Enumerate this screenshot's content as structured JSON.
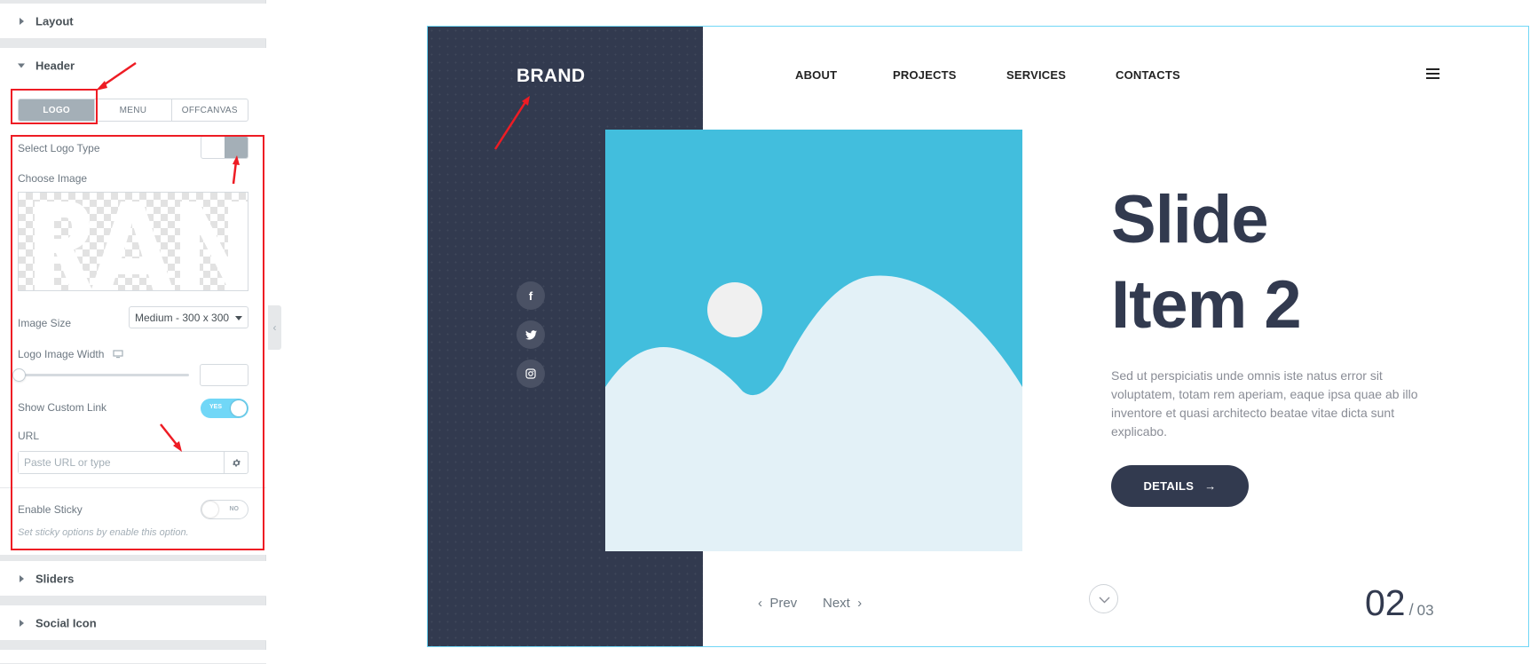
{
  "panel": {
    "sections": {
      "layout": "Layout",
      "header": "Header",
      "sliders": "Sliders",
      "social_icon": "Social Icon"
    },
    "header_tabs": [
      "LOGO",
      "MENU",
      "OFFCANVAS"
    ],
    "active_tab": "LOGO",
    "controls": {
      "select_logo_type": "Select Logo Type",
      "choose_image": "Choose Image",
      "image_size_label": "Image Size",
      "image_size_value": "Medium - 300 x 300",
      "logo_image_width": "Logo Image Width",
      "show_custom_link": "Show Custom Link",
      "show_custom_link_state": "YES",
      "url_label": "URL",
      "url_placeholder": "Paste URL or type",
      "enable_sticky": "Enable Sticky",
      "enable_sticky_state": "NO",
      "sticky_note": "Set sticky options by enable this option."
    },
    "icons": [
      "caret-right-icon",
      "caret-down-icon",
      "desktop-icon",
      "gear-icon",
      "chevron-left-icon"
    ]
  },
  "preview": {
    "brand": "BRAND",
    "nav": [
      "ABOUT",
      "PROJECTS",
      "SERVICES",
      "CONTACTS"
    ],
    "social": [
      "facebook-icon",
      "twitter-icon",
      "instagram-icon"
    ],
    "slide_title_1": "Slide",
    "slide_title_2": "Item 2",
    "slide_text": "Sed ut perspiciatis unde omnis iste natus error sit voluptatem, totam rem aperiam, eaque ipsa quae ab illo inventore et quasi architecto beatae vitae dicta sunt explicabo.",
    "details_button": "DETAILS",
    "prev": "Prev",
    "next": "Next",
    "current_slide": "02",
    "total_slides": "03"
  },
  "colors": {
    "dark": "#323a4f",
    "accent_blue": "#42bedd",
    "light_blue": "#e3f1f7",
    "annotation_red": "#ee1c24"
  }
}
